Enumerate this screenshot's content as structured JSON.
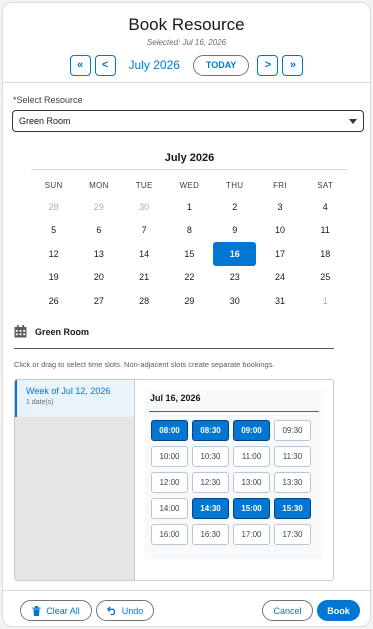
{
  "header": {
    "title": "Book Resource",
    "subtitle": "Selected: Jul 16, 2026",
    "nav": {
      "prev_year": "«",
      "prev_month": "<",
      "month_label": "July 2026",
      "today": "TODAY",
      "next_month": ">",
      "next_year": "»"
    }
  },
  "resource": {
    "required_mark": "*",
    "label": "Select Resource",
    "value": "Green Room"
  },
  "calendar": {
    "title": "July 2026",
    "weekdays": [
      "SUN",
      "MON",
      "TUE",
      "WED",
      "THU",
      "FRI",
      "SAT"
    ],
    "days": [
      {
        "d": "28",
        "out": true
      },
      {
        "d": "29",
        "out": true
      },
      {
        "d": "30",
        "out": true
      },
      {
        "d": "1"
      },
      {
        "d": "2"
      },
      {
        "d": "3"
      },
      {
        "d": "4"
      },
      {
        "d": "5"
      },
      {
        "d": "6"
      },
      {
        "d": "7"
      },
      {
        "d": "8"
      },
      {
        "d": "9"
      },
      {
        "d": "10"
      },
      {
        "d": "11"
      },
      {
        "d": "12"
      },
      {
        "d": "13"
      },
      {
        "d": "14"
      },
      {
        "d": "15"
      },
      {
        "d": "16",
        "selected": true
      },
      {
        "d": "17"
      },
      {
        "d": "18"
      },
      {
        "d": "19"
      },
      {
        "d": "20"
      },
      {
        "d": "21"
      },
      {
        "d": "22"
      },
      {
        "d": "23"
      },
      {
        "d": "24"
      },
      {
        "d": "25"
      },
      {
        "d": "26"
      },
      {
        "d": "27"
      },
      {
        "d": "28"
      },
      {
        "d": "29"
      },
      {
        "d": "30"
      },
      {
        "d": "31"
      },
      {
        "d": "1",
        "out": true
      }
    ]
  },
  "room": {
    "icon": "calendar-icon",
    "name": "Green Room"
  },
  "hint": "Click or drag to select time slots. Non-adjacent slots create separate bookings.",
  "week": {
    "label": "Week of Jul 12, 2026",
    "count": "1 date(s)"
  },
  "day_panel": {
    "date": "Jul 16, 2026",
    "slots": [
      {
        "t": "08:00",
        "on": true
      },
      {
        "t": "08:30",
        "on": true
      },
      {
        "t": "09:00",
        "on": true
      },
      {
        "t": "09:30"
      },
      {
        "t": "10:00"
      },
      {
        "t": "10:30"
      },
      {
        "t": "11:00"
      },
      {
        "t": "11:30"
      },
      {
        "t": "12:00"
      },
      {
        "t": "12:30"
      },
      {
        "t": "13:00"
      },
      {
        "t": "13:30"
      },
      {
        "t": "14:00"
      },
      {
        "t": "14:30",
        "on": true
      },
      {
        "t": "15:00",
        "on": true
      },
      {
        "t": "15:30",
        "on": true
      },
      {
        "t": "16:00"
      },
      {
        "t": "16:30"
      },
      {
        "t": "17:00"
      },
      {
        "t": "17:30"
      }
    ]
  },
  "footer": {
    "clear_all": "Clear All",
    "undo": "Undo",
    "cancel": "Cancel",
    "book": "Book"
  },
  "colors": {
    "brand": "#0176d3",
    "selected_border": "#014486"
  }
}
